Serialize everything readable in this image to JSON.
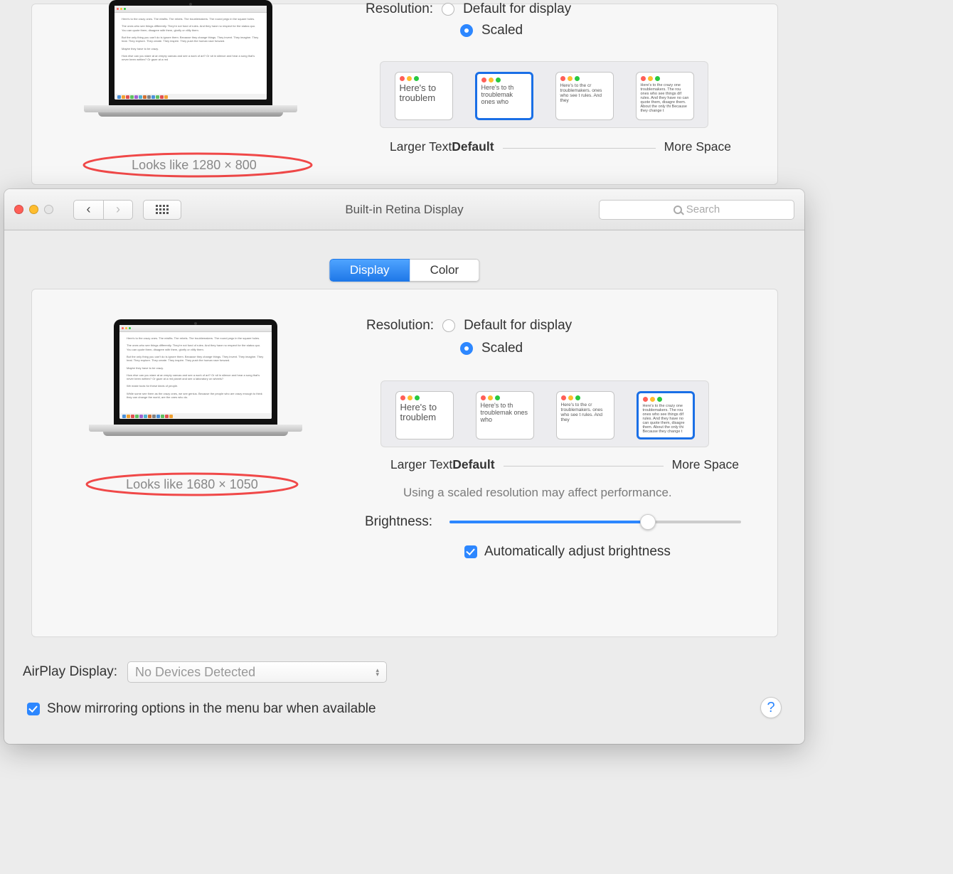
{
  "top": {
    "resolution_label": "Resolution:",
    "radio_default": "Default for display",
    "radio_scaled": "Scaled",
    "looks_like": "Looks like 1280 × 800",
    "caps": {
      "larger": "Larger Text",
      "default": "Default",
      "more": "More Space"
    },
    "thumb_texts": {
      "a": "Here's to troublem",
      "b": "Here's to th troublemak ones who",
      "c": "Here's to the cr troublemakers. ones who see t rules. And they",
      "d": "Here's to the crazy one troublemakers. The rou ones who see things dif rules. And they have no can quote them, disagre them. About the only thi Because they change t"
    }
  },
  "toolbar": {
    "title": "Built-in Retina Display",
    "search_placeholder": "Search"
  },
  "tabs": {
    "display": "Display",
    "color": "Color"
  },
  "main": {
    "resolution_label": "Resolution:",
    "radio_default": "Default for display",
    "radio_scaled": "Scaled",
    "looks_like": "Looks like 1680 × 1050",
    "caps": {
      "larger": "Larger Text",
      "default": "Default",
      "more": "More Space"
    },
    "thumb_texts": {
      "a": "Here's to troublem",
      "b": "Here's to th troublemak ones who",
      "c": "Here's to the cr troublemakers. ones who see t rules. And they",
      "d": "Here's to the crazy one troublemakers. The rou ones who see things dif rules. And they have no can quote them, disagre them. About the only thi Because they change t"
    },
    "perf_note": "Using a scaled resolution may affect performance.",
    "brightness_label": "Brightness:",
    "auto_brightness": "Automatically adjust brightness"
  },
  "footer": {
    "airplay_label": "AirPlay Display:",
    "airplay_value": "No Devices Detected",
    "show_mirror": "Show mirroring options in the menu bar when available",
    "help": "?"
  }
}
